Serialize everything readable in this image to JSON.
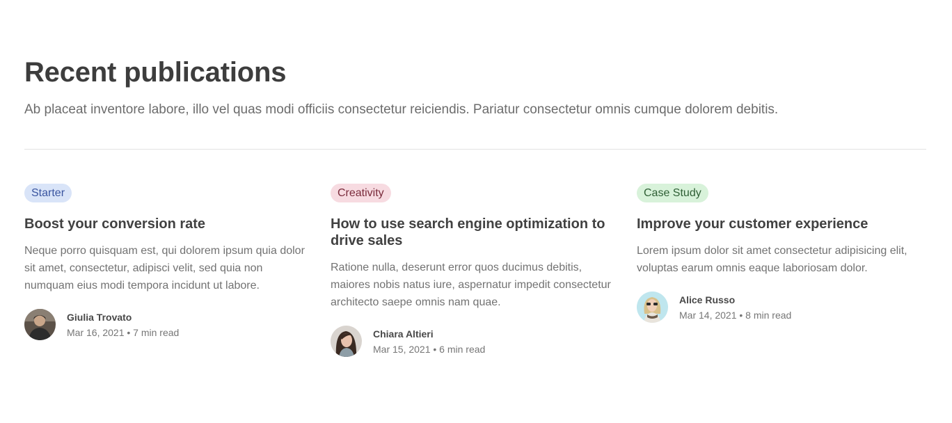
{
  "header": {
    "title": "Recent publications",
    "subtitle": "Ab placeat inventore labore, illo vel quas modi officiis consectetur reiciendis. Pariatur consectetur omnis cumque dolorem debitis."
  },
  "posts": [
    {
      "category": "Starter",
      "category_bg": "#d9e4f8",
      "category_color": "#3a55a0",
      "title": "Boost your conversion rate",
      "excerpt": "Neque porro quisquam est, qui dolorem ipsum quia dolor sit amet, consectetur, adipisci velit, sed quia non numquam eius modi tempora incidunt ut labore.",
      "author": "Giulia Trovato",
      "meta": "Mar 16, 2021 • 7 min read",
      "avatar_icon": "avatar-photo-icon"
    },
    {
      "category": "Creativity",
      "category_bg": "#f7dbe1",
      "category_color": "#7a2b3b",
      "title": "How to use search engine optimization to drive sales",
      "excerpt": "Ratione nulla, deserunt error quos ducimus debitis, maiores nobis natus iure, aspernatur impedit consectetur architecto saepe omnis nam quae.",
      "author": "Chiara Altieri",
      "meta": "Mar 15, 2021 • 6 min read",
      "avatar_icon": "avatar-photo-icon"
    },
    {
      "category": "Case Study",
      "category_bg": "#d8f2da",
      "category_color": "#2f5f35",
      "title": "Improve your customer experience",
      "excerpt": "Lorem ipsum dolor sit amet consectetur adipisicing elit, voluptas earum omnis eaque laboriosam dolor.",
      "author": "Alice Russo",
      "meta": "Mar 14, 2021 • 8 min read",
      "avatar_icon": "avatar-photo-icon"
    }
  ]
}
